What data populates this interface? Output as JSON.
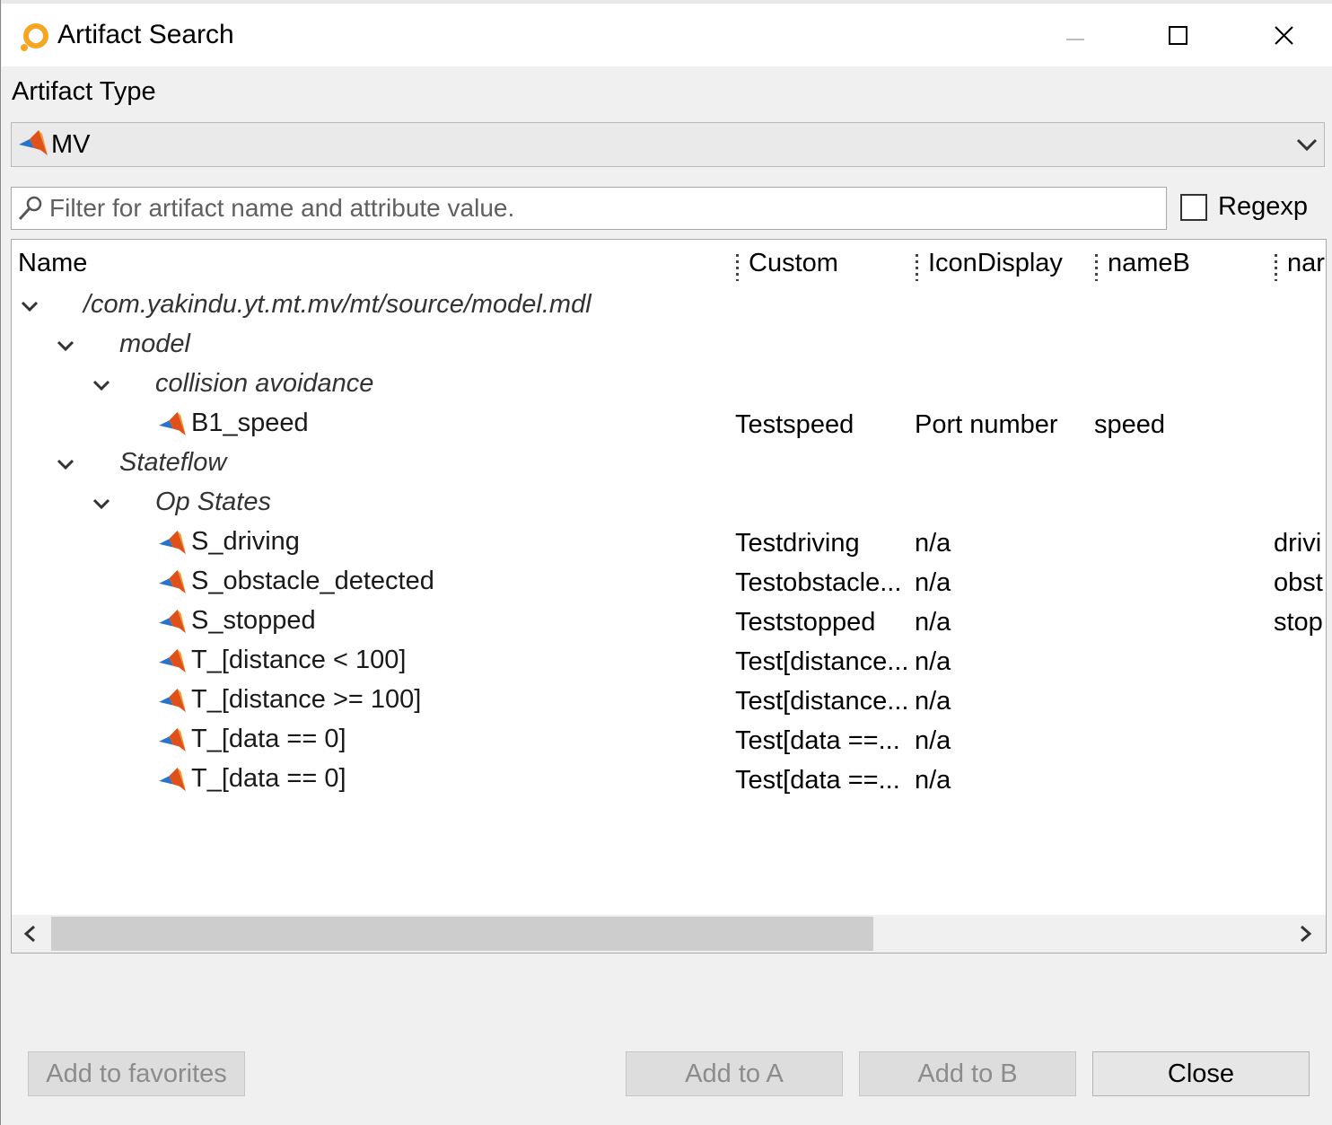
{
  "window": {
    "title": "Artifact Search",
    "icon": "yakindu-logo-icon",
    "controls": [
      "minimize-icon",
      "maximize-icon",
      "close-icon"
    ]
  },
  "artifact_type": {
    "label": "Artifact Type",
    "selected": "MV",
    "icon": "matlab-icon"
  },
  "filter": {
    "placeholder": "Filter for artifact name and attribute value.",
    "value": "",
    "regexp_label": "Regexp",
    "regexp_checked": false
  },
  "table": {
    "columns": [
      "Name",
      "Custom",
      "IconDisplay",
      "nameB",
      "nar"
    ],
    "rows": [
      {
        "name": "/com.yakindu.yt.mt.mv/mt/source/model.mdl",
        "folder": true,
        "custom": "",
        "icon_display": "",
        "nameB": "",
        "nar": ""
      },
      {
        "name": "model",
        "folder": true,
        "custom": "",
        "icon_display": "",
        "nameB": "",
        "nar": ""
      },
      {
        "name": "collision avoidance",
        "folder": true,
        "custom": "",
        "icon_display": "",
        "nameB": "",
        "nar": ""
      },
      {
        "name": "B1_speed",
        "folder": false,
        "custom": "Testspeed",
        "icon_display": "Port number",
        "nameB": "speed",
        "nar": ""
      },
      {
        "name": "Stateflow",
        "folder": true,
        "custom": "",
        "icon_display": "",
        "nameB": "",
        "nar": ""
      },
      {
        "name": "Op States",
        "folder": true,
        "custom": "",
        "icon_display": "",
        "nameB": "",
        "nar": ""
      },
      {
        "name": "S_driving",
        "folder": false,
        "custom": "Testdriving",
        "icon_display": "n/a",
        "nameB": "",
        "nar": "drivi"
      },
      {
        "name": "S_obstacle_detected",
        "folder": false,
        "custom": "Testobstacle...",
        "icon_display": "n/a",
        "nameB": "",
        "nar": "obst"
      },
      {
        "name": "S_stopped",
        "folder": false,
        "custom": "Teststopped",
        "icon_display": "n/a",
        "nameB": "",
        "nar": "stop"
      },
      {
        "name": "T_[distance < 100]",
        "folder": false,
        "custom": "Test[distance...",
        "icon_display": "n/a",
        "nameB": "",
        "nar": ""
      },
      {
        "name": "T_[distance >= 100]",
        "folder": false,
        "custom": "Test[distance...",
        "icon_display": "n/a",
        "nameB": "",
        "nar": ""
      },
      {
        "name": "T_[data == 0]",
        "folder": false,
        "custom": "Test[data ==...",
        "icon_display": "n/a",
        "nameB": "",
        "nar": ""
      },
      {
        "name": "T_[data == 0]",
        "folder": false,
        "custom": "Test[data ==...",
        "icon_display": "n/a",
        "nameB": "",
        "nar": ""
      }
    ]
  },
  "buttons": {
    "add_to_favorites": "Add to favorites",
    "add_to_a": "Add to A",
    "add_to_b": "Add to B",
    "close": "Close"
  }
}
